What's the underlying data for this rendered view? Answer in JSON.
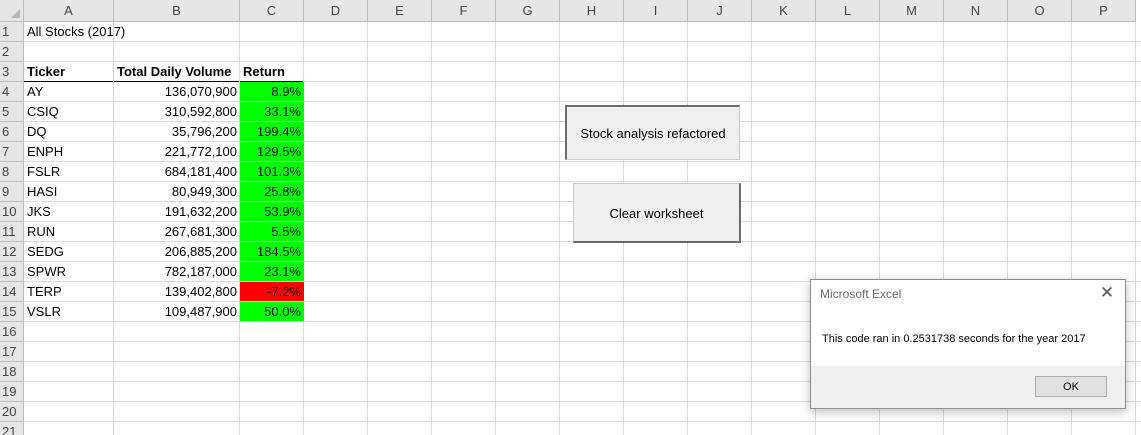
{
  "columns": [
    "A",
    "B",
    "C",
    "D",
    "E",
    "F",
    "G",
    "H",
    "I",
    "J",
    "K",
    "L",
    "M",
    "N",
    "O",
    "P"
  ],
  "rows": [
    "1",
    "2",
    "3",
    "4",
    "5",
    "6",
    "7",
    "8",
    "9",
    "10",
    "11",
    "12",
    "13",
    "14",
    "15",
    "16",
    "17",
    "18",
    "19",
    "20",
    "21"
  ],
  "title_cell": "All Stocks (2017)",
  "table": {
    "headers": [
      "Ticker",
      "Total Daily Volume",
      "Return"
    ],
    "rows": [
      {
        "ticker": "AY",
        "volume": "136,070,900",
        "ret": "8.9%",
        "color": "#00ff00"
      },
      {
        "ticker": "CSIQ",
        "volume": "310,592,800",
        "ret": "33.1%",
        "color": "#00ff00"
      },
      {
        "ticker": "DQ",
        "volume": "35,796,200",
        "ret": "199.4%",
        "color": "#00ff00"
      },
      {
        "ticker": "ENPH",
        "volume": "221,772,100",
        "ret": "129.5%",
        "color": "#00ff00"
      },
      {
        "ticker": "FSLR",
        "volume": "684,181,400",
        "ret": "101.3%",
        "color": "#00ff00"
      },
      {
        "ticker": "HASI",
        "volume": "80,949,300",
        "ret": "25.8%",
        "color": "#00ff00"
      },
      {
        "ticker": "JKS",
        "volume": "191,632,200",
        "ret": "53.9%",
        "color": "#00ff00"
      },
      {
        "ticker": "RUN",
        "volume": "267,681,300",
        "ret": "5.5%",
        "color": "#00ff00"
      },
      {
        "ticker": "SEDG",
        "volume": "206,885,200",
        "ret": "184.5%",
        "color": "#00ff00"
      },
      {
        "ticker": "SPWR",
        "volume": "782,187,000",
        "ret": "23.1%",
        "color": "#00ff00"
      },
      {
        "ticker": "TERP",
        "volume": "139,402,800",
        "ret": "-7.2%",
        "color": "#ff0000"
      },
      {
        "ticker": "VSLR",
        "volume": "109,487,900",
        "ret": "50.0%",
        "color": "#00ff00"
      }
    ]
  },
  "buttons": {
    "refactor_label": "Stock analysis refactored",
    "clear_label": "Clear worksheet"
  },
  "dialog": {
    "title": "Microsoft Excel",
    "message": "This code ran in 0.2531738 seconds for the year 2017",
    "ok_label": "OK",
    "close_glyph": "✕"
  }
}
